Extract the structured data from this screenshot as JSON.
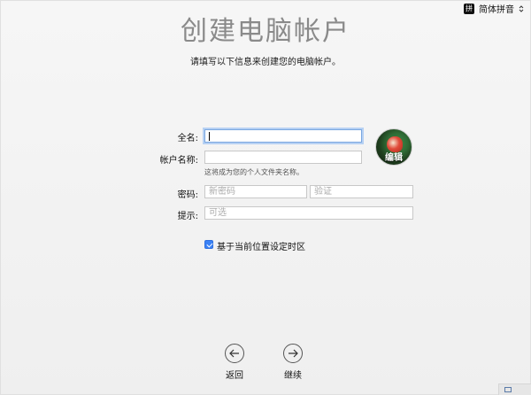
{
  "title": "创建电脑帐户",
  "subtitle": "请填写以下信息来创建您的电脑帐户。",
  "ime": {
    "badge": "拼",
    "label": "简体拼音",
    "icon": "up-down-chevron-icon"
  },
  "form": {
    "full_name": {
      "label": "全名:",
      "value": ""
    },
    "account_name": {
      "label": "帐户名称:",
      "value": "",
      "hint": "这将成为您的个人文件夹名称。"
    },
    "password": {
      "label": "密码:",
      "placeholder_new": "新密码",
      "placeholder_verify": "验证"
    },
    "hint": {
      "label": "提示:",
      "placeholder": "可选"
    }
  },
  "avatar": {
    "edit_label": "编辑",
    "icon": "avatar-parrot-image"
  },
  "timezone_checkbox": {
    "label": "基于当前位置设定时区",
    "checked": true
  },
  "nav": {
    "back_label": "返回",
    "continue_label": "继续"
  },
  "colors": {
    "accent": "#3b82f6",
    "focus_ring": "#b7d1f3",
    "title_gray": "#8a8a8a"
  }
}
